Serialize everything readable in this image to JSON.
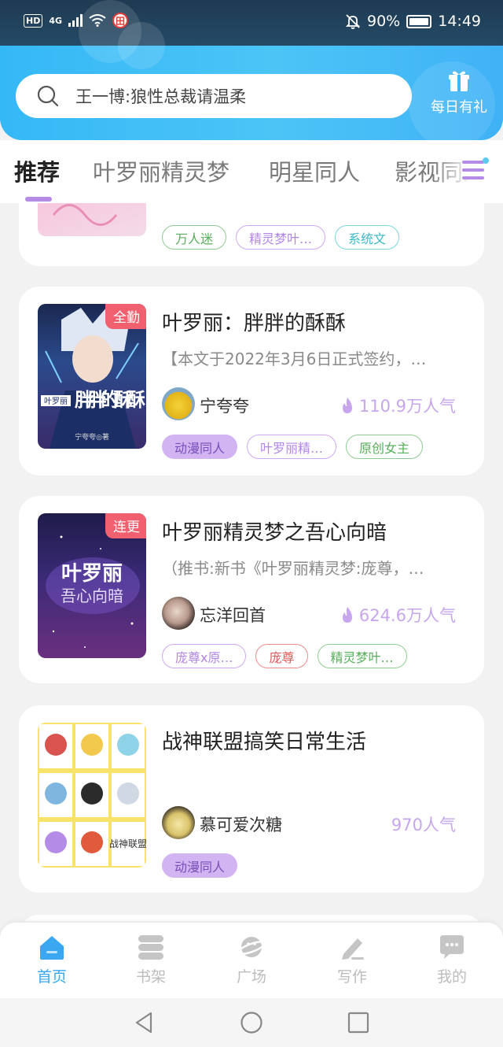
{
  "status_bar": {
    "network": "4G",
    "hd": "HD",
    "badge": "田",
    "battery": "90%",
    "time": "14:49"
  },
  "search": {
    "placeholder": "王一博:狼性总裁请温柔",
    "icon": "search-icon"
  },
  "gift": {
    "label": "每日有礼",
    "icon": "gift-icon"
  },
  "tabs": [
    {
      "label": "推荐",
      "active": true
    },
    {
      "label": "叶罗丽精灵梦",
      "active": false
    },
    {
      "label": "明星同人",
      "active": false
    },
    {
      "label": "影视同人",
      "active": false
    }
  ],
  "books": [
    {
      "title": "",
      "tags": [
        "万人迷",
        "精灵梦叶…",
        "系统文"
      ],
      "tag_styles": [
        "green-out",
        "purple-out",
        "teal-out"
      ]
    },
    {
      "title": "叶罗丽：胖胖的酥酥",
      "corner_badge": "全勤",
      "description": "【本文于2022年3月6日正式签约，…",
      "author": "宁夸夸",
      "popularity": "110.9万人气",
      "tags": [
        "动漫同人",
        "叶罗丽精…",
        "原创女主"
      ],
      "tag_styles": [
        "purple-fill",
        "purple-out",
        "green-out"
      ],
      "cover_title": "胖胖的酥酥",
      "cover_sub": "叶罗丽",
      "cover_author": "宁夸夸◎著"
    },
    {
      "title": "叶罗丽精灵梦之吾心向暗",
      "corner_badge": "连更",
      "description": "（推书:新书《叶罗丽精灵梦:庞尊，…",
      "author": "忘洋回首",
      "popularity": "624.6万人气",
      "tags": [
        "庞尊x原…",
        "庞尊",
        "精灵梦叶…"
      ],
      "tag_styles": [
        "purple-out",
        "red-out",
        "green-out"
      ],
      "cover_title": "叶罗丽",
      "cover_sub": "吾心向暗"
    },
    {
      "title": "战神联盟搞笑日常生活",
      "description": "",
      "author": "慕可爱次糖",
      "popularity": "970人气",
      "tags": [
        "动漫同人"
      ],
      "tag_styles": [
        "purple-fill"
      ],
      "cover_text": "战神联盟"
    }
  ],
  "bottom_nav": [
    {
      "label": "首页",
      "icon": "home-icon",
      "active": true
    },
    {
      "label": "书架",
      "icon": "bookshelf-icon",
      "active": false
    },
    {
      "label": "广场",
      "icon": "planet-icon",
      "active": false
    },
    {
      "label": "写作",
      "icon": "pen-icon",
      "active": false
    },
    {
      "label": "我的",
      "icon": "chat-bubble-icon",
      "active": false
    }
  ],
  "colors": {
    "header_blue": "#3fb9f6",
    "accent_purple": "#b48be6",
    "nav_active": "#3aa7f0",
    "badge_red": "#f0606e"
  }
}
